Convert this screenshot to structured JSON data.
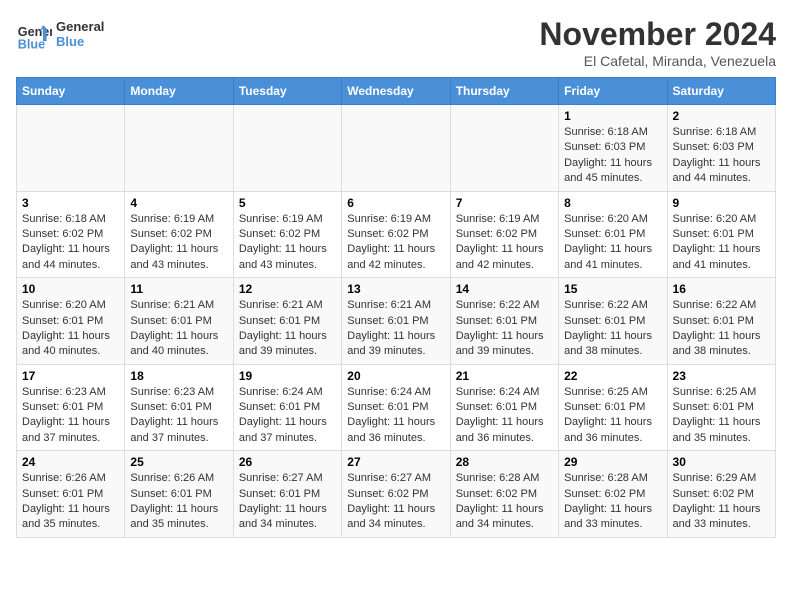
{
  "header": {
    "logo_line1": "General",
    "logo_line2": "Blue",
    "month_title": "November 2024",
    "location": "El Cafetal, Miranda, Venezuela"
  },
  "days_of_week": [
    "Sunday",
    "Monday",
    "Tuesday",
    "Wednesday",
    "Thursday",
    "Friday",
    "Saturday"
  ],
  "weeks": [
    [
      {
        "day": "",
        "info": ""
      },
      {
        "day": "",
        "info": ""
      },
      {
        "day": "",
        "info": ""
      },
      {
        "day": "",
        "info": ""
      },
      {
        "day": "",
        "info": ""
      },
      {
        "day": "1",
        "info": "Sunrise: 6:18 AM\nSunset: 6:03 PM\nDaylight: 11 hours and 45 minutes."
      },
      {
        "day": "2",
        "info": "Sunrise: 6:18 AM\nSunset: 6:03 PM\nDaylight: 11 hours and 44 minutes."
      }
    ],
    [
      {
        "day": "3",
        "info": "Sunrise: 6:18 AM\nSunset: 6:02 PM\nDaylight: 11 hours and 44 minutes."
      },
      {
        "day": "4",
        "info": "Sunrise: 6:19 AM\nSunset: 6:02 PM\nDaylight: 11 hours and 43 minutes."
      },
      {
        "day": "5",
        "info": "Sunrise: 6:19 AM\nSunset: 6:02 PM\nDaylight: 11 hours and 43 minutes."
      },
      {
        "day": "6",
        "info": "Sunrise: 6:19 AM\nSunset: 6:02 PM\nDaylight: 11 hours and 42 minutes."
      },
      {
        "day": "7",
        "info": "Sunrise: 6:19 AM\nSunset: 6:02 PM\nDaylight: 11 hours and 42 minutes."
      },
      {
        "day": "8",
        "info": "Sunrise: 6:20 AM\nSunset: 6:01 PM\nDaylight: 11 hours and 41 minutes."
      },
      {
        "day": "9",
        "info": "Sunrise: 6:20 AM\nSunset: 6:01 PM\nDaylight: 11 hours and 41 minutes."
      }
    ],
    [
      {
        "day": "10",
        "info": "Sunrise: 6:20 AM\nSunset: 6:01 PM\nDaylight: 11 hours and 40 minutes."
      },
      {
        "day": "11",
        "info": "Sunrise: 6:21 AM\nSunset: 6:01 PM\nDaylight: 11 hours and 40 minutes."
      },
      {
        "day": "12",
        "info": "Sunrise: 6:21 AM\nSunset: 6:01 PM\nDaylight: 11 hours and 39 minutes."
      },
      {
        "day": "13",
        "info": "Sunrise: 6:21 AM\nSunset: 6:01 PM\nDaylight: 11 hours and 39 minutes."
      },
      {
        "day": "14",
        "info": "Sunrise: 6:22 AM\nSunset: 6:01 PM\nDaylight: 11 hours and 39 minutes."
      },
      {
        "day": "15",
        "info": "Sunrise: 6:22 AM\nSunset: 6:01 PM\nDaylight: 11 hours and 38 minutes."
      },
      {
        "day": "16",
        "info": "Sunrise: 6:22 AM\nSunset: 6:01 PM\nDaylight: 11 hours and 38 minutes."
      }
    ],
    [
      {
        "day": "17",
        "info": "Sunrise: 6:23 AM\nSunset: 6:01 PM\nDaylight: 11 hours and 37 minutes."
      },
      {
        "day": "18",
        "info": "Sunrise: 6:23 AM\nSunset: 6:01 PM\nDaylight: 11 hours and 37 minutes."
      },
      {
        "day": "19",
        "info": "Sunrise: 6:24 AM\nSunset: 6:01 PM\nDaylight: 11 hours and 37 minutes."
      },
      {
        "day": "20",
        "info": "Sunrise: 6:24 AM\nSunset: 6:01 PM\nDaylight: 11 hours and 36 minutes."
      },
      {
        "day": "21",
        "info": "Sunrise: 6:24 AM\nSunset: 6:01 PM\nDaylight: 11 hours and 36 minutes."
      },
      {
        "day": "22",
        "info": "Sunrise: 6:25 AM\nSunset: 6:01 PM\nDaylight: 11 hours and 36 minutes."
      },
      {
        "day": "23",
        "info": "Sunrise: 6:25 AM\nSunset: 6:01 PM\nDaylight: 11 hours and 35 minutes."
      }
    ],
    [
      {
        "day": "24",
        "info": "Sunrise: 6:26 AM\nSunset: 6:01 PM\nDaylight: 11 hours and 35 minutes."
      },
      {
        "day": "25",
        "info": "Sunrise: 6:26 AM\nSunset: 6:01 PM\nDaylight: 11 hours and 35 minutes."
      },
      {
        "day": "26",
        "info": "Sunrise: 6:27 AM\nSunset: 6:01 PM\nDaylight: 11 hours and 34 minutes."
      },
      {
        "day": "27",
        "info": "Sunrise: 6:27 AM\nSunset: 6:02 PM\nDaylight: 11 hours and 34 minutes."
      },
      {
        "day": "28",
        "info": "Sunrise: 6:28 AM\nSunset: 6:02 PM\nDaylight: 11 hours and 34 minutes."
      },
      {
        "day": "29",
        "info": "Sunrise: 6:28 AM\nSunset: 6:02 PM\nDaylight: 11 hours and 33 minutes."
      },
      {
        "day": "30",
        "info": "Sunrise: 6:29 AM\nSunset: 6:02 PM\nDaylight: 11 hours and 33 minutes."
      }
    ]
  ]
}
